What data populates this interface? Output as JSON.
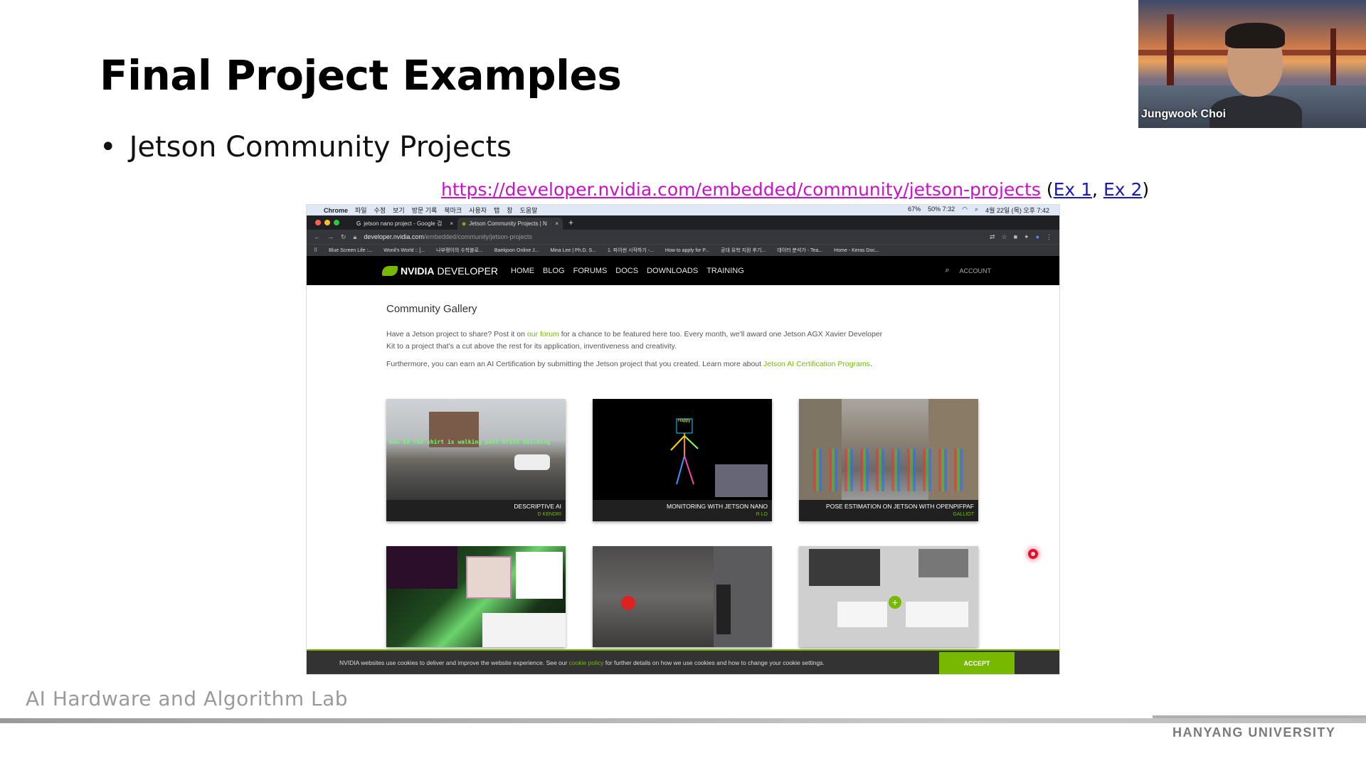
{
  "slide": {
    "title": "Final Project Examples",
    "bullet": "Jetson Community Projects",
    "link_url": "https://developer.nvidia.com/embedded/community/jetson-projects",
    "link_open": "(",
    "ex1": "Ex 1",
    "comma": ", ",
    "ex2": "Ex 2",
    "link_close": ")"
  },
  "webcam": {
    "name": "Jungwook Choi"
  },
  "browser": {
    "menubar": {
      "items": [
        "Chrome",
        "파일",
        "수정",
        "보기",
        "방문 기록",
        "북마크",
        "사용자",
        "탭",
        "창",
        "도움말"
      ],
      "status": "67%",
      "battery": "50% 7:32",
      "clock": "4월 22일 (목) 오후 7:42"
    },
    "tabs": [
      {
        "label": "jetson nano project - Google 검"
      },
      {
        "label": "Jetson Community Projects | N"
      }
    ],
    "url_host": "developer.nvidia.com",
    "url_path": "/embedded/community/jetson-projects",
    "bookmarks": [
      "Blue Screen Life :...",
      "Wonil's World :: [...",
      "나부랭이의 수학블로...",
      "Baekjoon Online J...",
      "Mina Lee | Ph.D. S...",
      "1. 파이썬 시작하기 -...",
      "How to apply for P...",
      "공대 유학 지원 후기...",
      "데이터 분석가 - Tea...",
      "Home - Keras Doc..."
    ]
  },
  "nvidia": {
    "brand": "NVIDIA",
    "brand_sub": "DEVELOPER",
    "nav": [
      "HOME",
      "BLOG",
      "FORUMS",
      "DOCS",
      "DOWNLOADS",
      "TRAINING"
    ],
    "account": "ACCOUNT",
    "gallery_title": "Community Gallery",
    "p1_a": "Have a Jetson project to share? Post it on ",
    "p1_link": "our forum",
    "p1_b": " for a chance to be featured here too. Every month, we'll award one Jetson AGX Xavier Developer Kit to a project that's a cut above the rest for its application, inventiveness and creativity.",
    "p2_a": "Furthermore, you can earn an AI Certification by submitting the Jetson project that you created. Learn more about ",
    "p2_link": "Jetson AI Certification Programs",
    "p2_b": "."
  },
  "cards": [
    {
      "title": "DESCRIPTIVE AI",
      "author": "D KENDRI",
      "overlay": "man in red shirt is walking past brick building"
    },
    {
      "title": "MONITORING WITH JETSON NANO",
      "author": "R LO",
      "overlay": "Happy"
    },
    {
      "title": "POSE ESTIMATION ON JETSON WITH OPENPIFPAF",
      "author": "GALLIOT",
      "overlay": ""
    },
    {
      "title": "",
      "author": "",
      "overlay": ""
    },
    {
      "title": "",
      "author": "",
      "overlay": ""
    },
    {
      "title": "",
      "author": "",
      "overlay": ""
    }
  ],
  "cookie": {
    "text_a": "NVIDIA websites use cookies to deliver and improve the website experience. See our ",
    "link": "cookie policy",
    "text_b": " for further details on how we use cookies and how to change your cookie settings.",
    "accept": "ACCEPT"
  },
  "footer": {
    "lab": "AI Hardware and Algorithm Lab",
    "university": "HANYANG UNIVERSITY"
  },
  "colors": {
    "nvidia_green": "#76b900",
    "url_link": "#c812c8",
    "ex_link": "#1a1ab4"
  }
}
